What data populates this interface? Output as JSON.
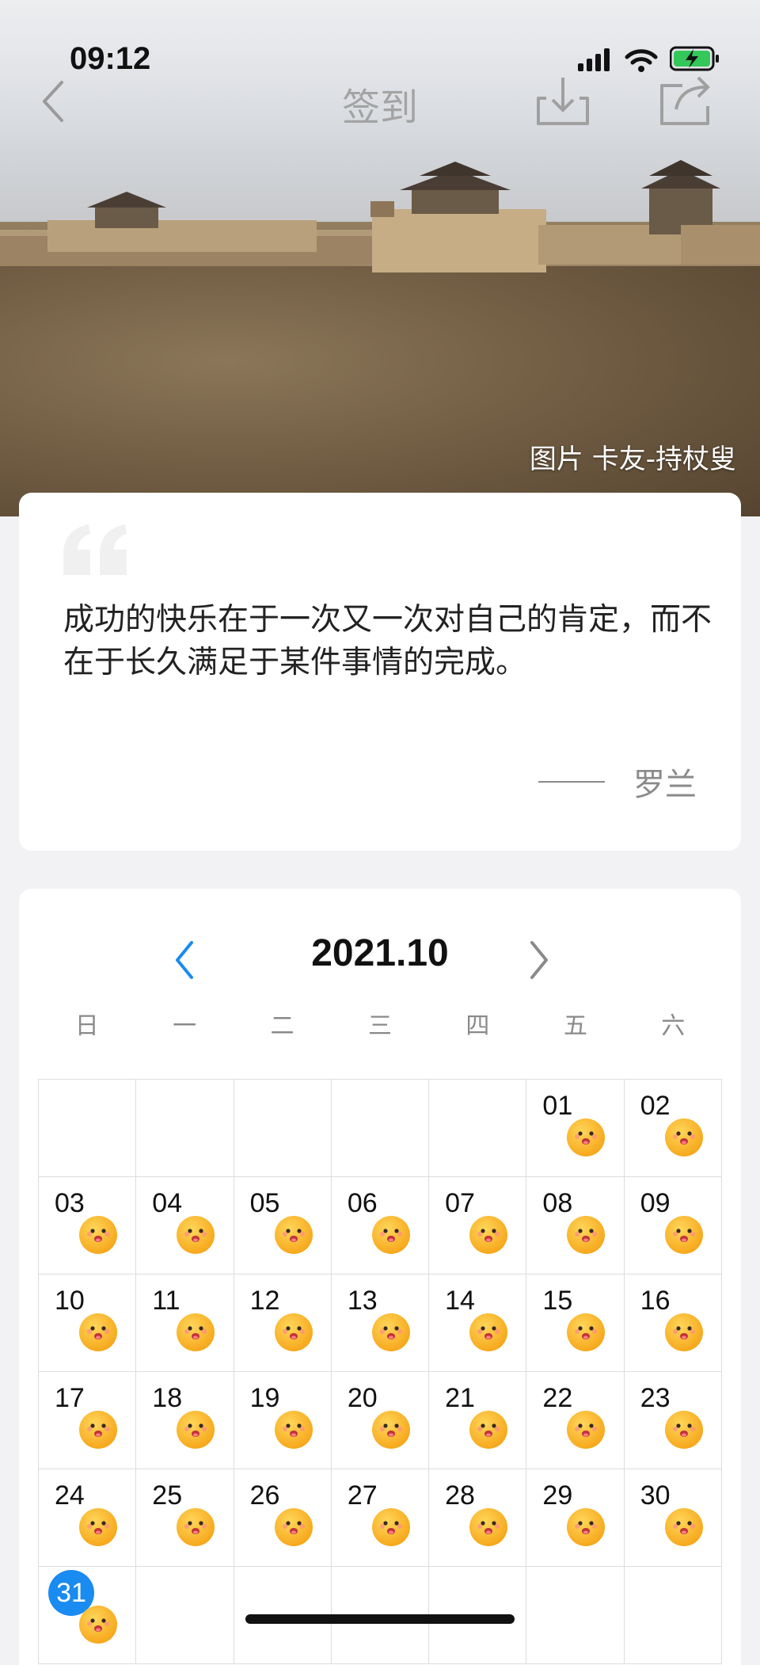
{
  "status_bar": {
    "time": "09:12"
  },
  "nav": {
    "title": "签到"
  },
  "hero": {
    "credit": "图片 卡友-持杖叟"
  },
  "quote": {
    "text": "成功的快乐在于一次又一次对自己的肯定，而不在于长久满足于某件事情的完成。",
    "author": "罗兰"
  },
  "calendar": {
    "month": "2021.10",
    "weekdays": [
      "日",
      "一",
      "二",
      "三",
      "四",
      "五",
      "六"
    ],
    "leading_blank_days": 5,
    "days": [
      "01",
      "02",
      "03",
      "04",
      "05",
      "06",
      "07",
      "08",
      "09",
      "10",
      "11",
      "12",
      "13",
      "14",
      "15",
      "16",
      "17",
      "18",
      "19",
      "20",
      "21",
      "22",
      "23",
      "24",
      "25",
      "26",
      "27",
      "28",
      "29",
      "30",
      "31"
    ],
    "today": "31",
    "checked_in_icon": "smiley-face-icon"
  },
  "colors": {
    "accent": "#1a8bf0",
    "face": "#f6a417"
  }
}
